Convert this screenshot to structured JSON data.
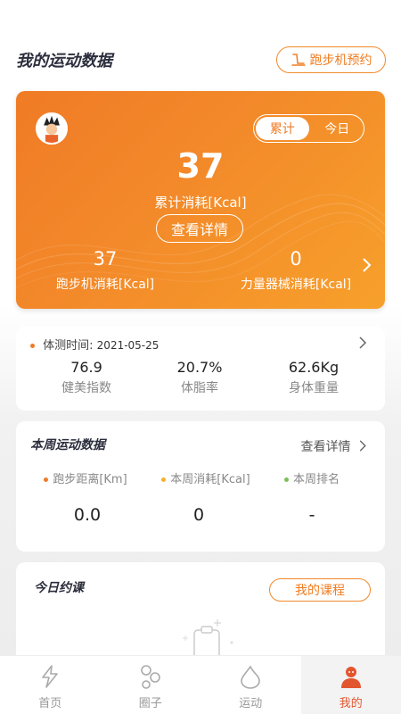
{
  "header": {
    "title": "我的运动数据",
    "treadmill_booking_label": "跑步机预约"
  },
  "summary_card": {
    "segments": [
      "累计",
      "今日"
    ],
    "active_segment": "累计",
    "total_value": "37",
    "total_label": "累计消耗[Kcal]",
    "detail_button": "查看详情",
    "treadmill": {
      "value": "37",
      "label": "跑步机消耗[Kcal]"
    },
    "strength": {
      "value": "0",
      "label": "力量器械消耗[Kcal]"
    }
  },
  "body_measure": {
    "label": "体测时间:",
    "date": "2021-05-25",
    "metrics": [
      {
        "value": "76.9",
        "label": "健美指数"
      },
      {
        "value": "20.7%",
        "label": "体脂率"
      },
      {
        "value": "62.6Kg",
        "label": "身体重量"
      }
    ]
  },
  "weekly": {
    "title": "本周运动数据",
    "see_detail": "查看详情",
    "items": [
      {
        "label": "跑步距离[Km]",
        "value": "0.0",
        "dot_color": "#f07b26"
      },
      {
        "label": "本周消耗[Kcal]",
        "value": "0",
        "dot_color": "#f5b12a"
      },
      {
        "label": "本周排名",
        "value": "-",
        "dot_color": "#7bbf5a"
      }
    ]
  },
  "today_course": {
    "title": "今日约课",
    "my_course_button": "我的课程"
  },
  "tabbar": {
    "items": [
      {
        "label": "首页",
        "icon": "lightning-icon"
      },
      {
        "label": "圈子",
        "icon": "circles-icon"
      },
      {
        "label": "运动",
        "icon": "droplet-icon"
      },
      {
        "label": "我的",
        "icon": "user-icon"
      }
    ],
    "active": "我的"
  },
  "colors": {
    "accent": "#f07b26",
    "tab_active": "#e2562f",
    "title": "#2b2e3c"
  }
}
